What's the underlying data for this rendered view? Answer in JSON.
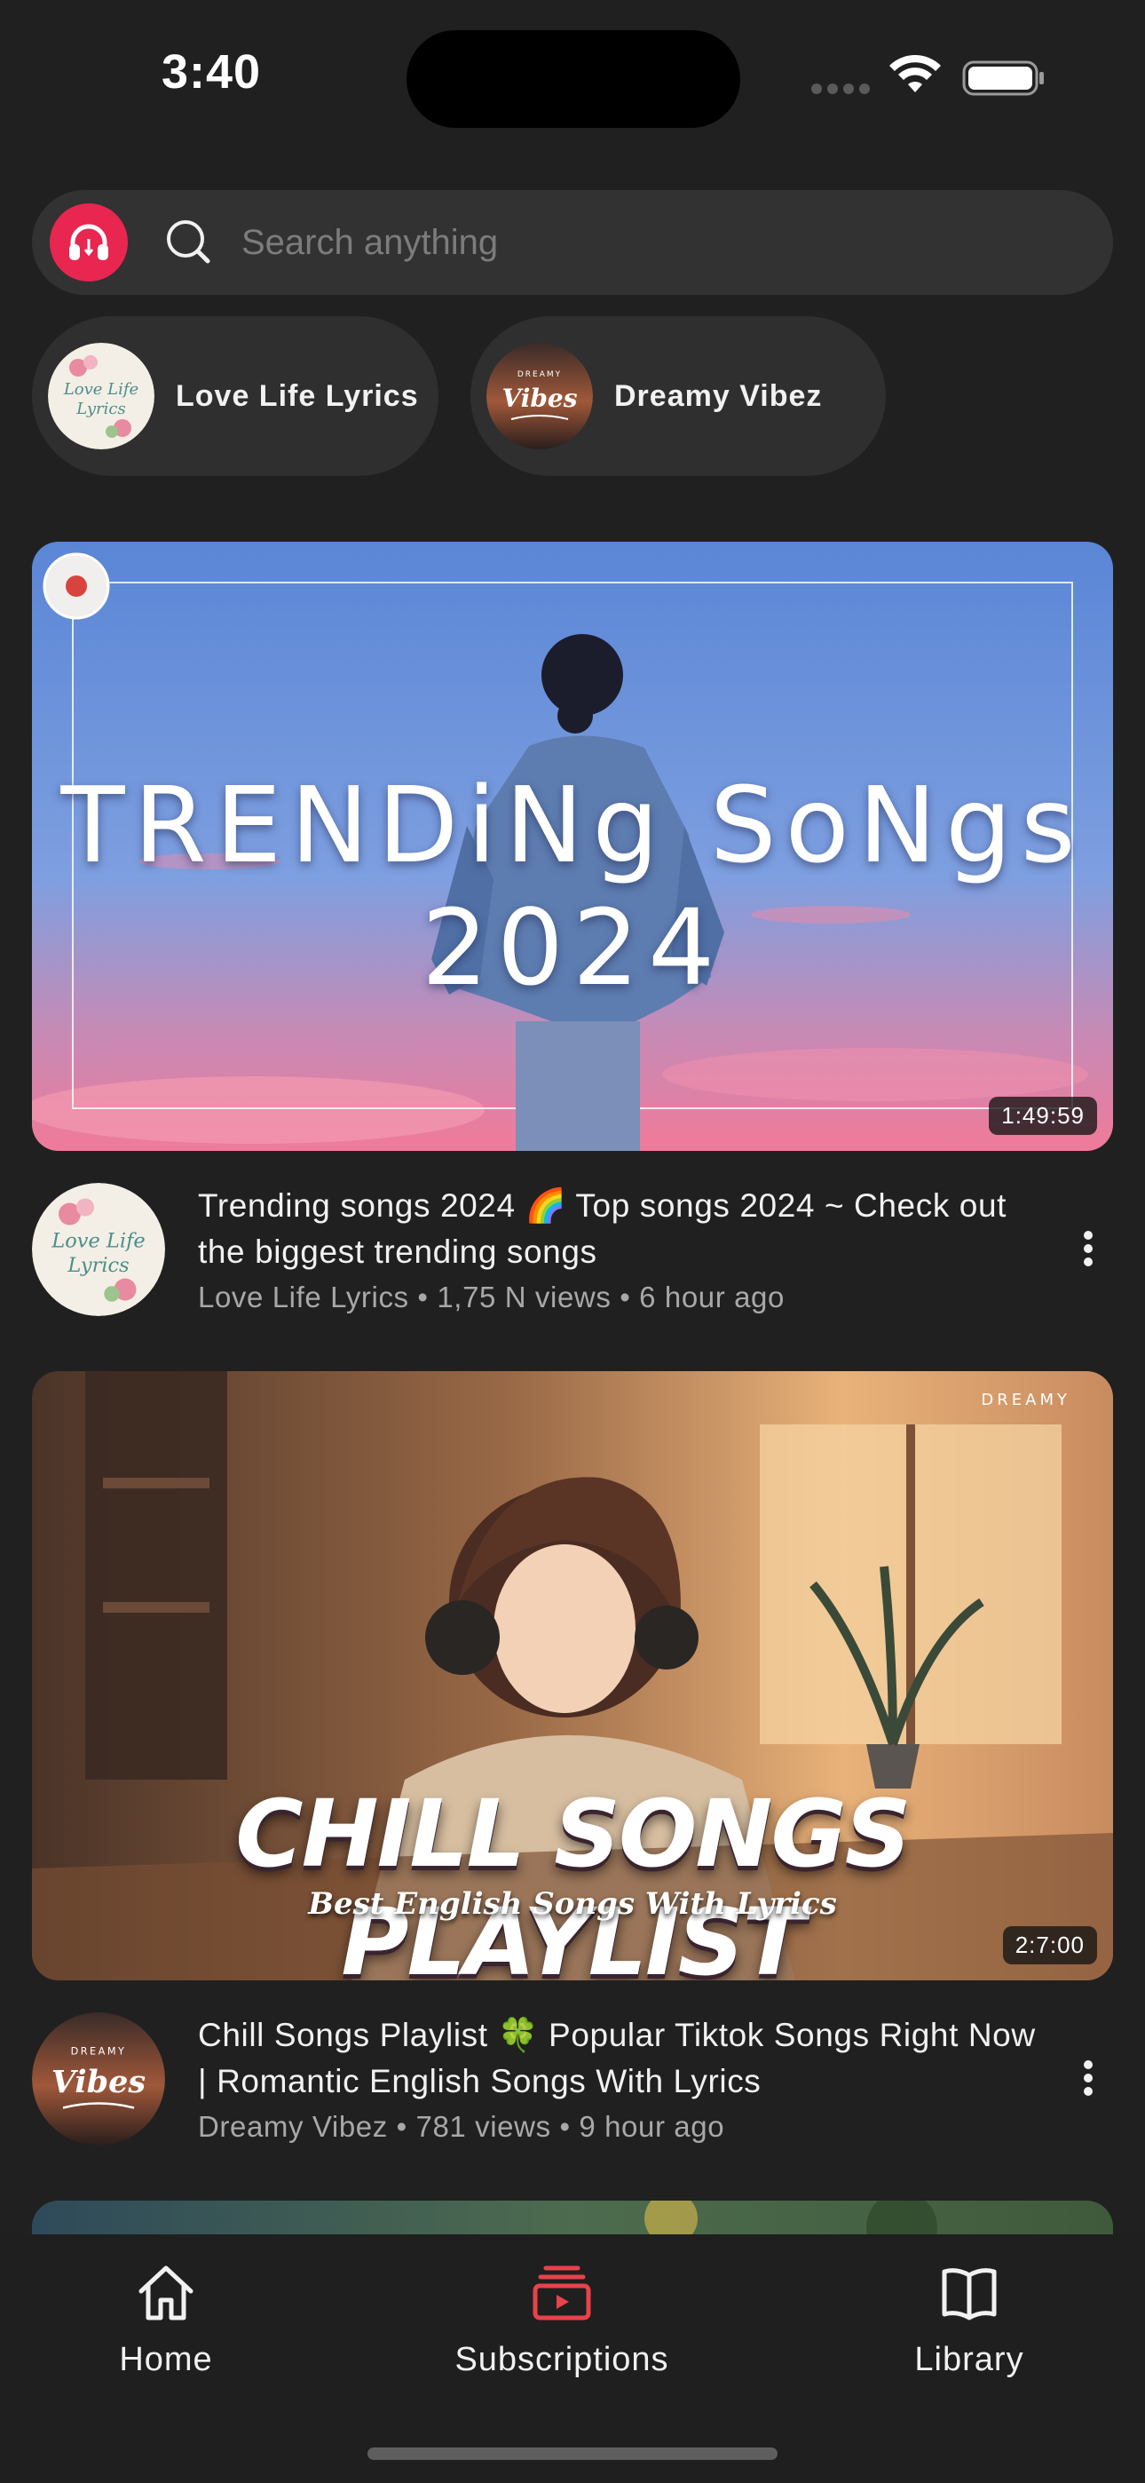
{
  "status_bar": {
    "time": "3:40"
  },
  "search": {
    "placeholder": "Search anything"
  },
  "channels": [
    {
      "name": "Love Life Lyrics"
    },
    {
      "name": "Dreamy Vibez"
    }
  ],
  "videos": [
    {
      "thumbnail_text": "TRENDiNg SoNgs 2024",
      "duration": "1:49:59",
      "title": "Trending songs 2024 🌈 Top songs 2024 ~ Check out the biggest trending songs",
      "meta": "Love Life Lyrics • 1,75 N views • 6 hour ago"
    },
    {
      "thumbnail_text": "CHILL SONGS PLAYLIST",
      "thumbnail_subtext": "Best English Songs With Lyrics",
      "duration": "2:7:00",
      "title": "Chill Songs Playlist 🍀 Popular Tiktok Songs Right Now | Romantic English Songs With Lyrics",
      "meta": "Dreamy Vibez • 781 views • 9 hour ago"
    }
  ],
  "tabs": [
    {
      "label": "Home",
      "icon": "home-icon",
      "active": false
    },
    {
      "label": "Subscriptions",
      "icon": "subscriptions-icon",
      "active": true
    },
    {
      "label": "Library",
      "icon": "library-icon",
      "active": false
    }
  ],
  "colors": {
    "accent": "#e8264f",
    "background": "#202020",
    "subscriptions_icon": "#e8424a"
  }
}
